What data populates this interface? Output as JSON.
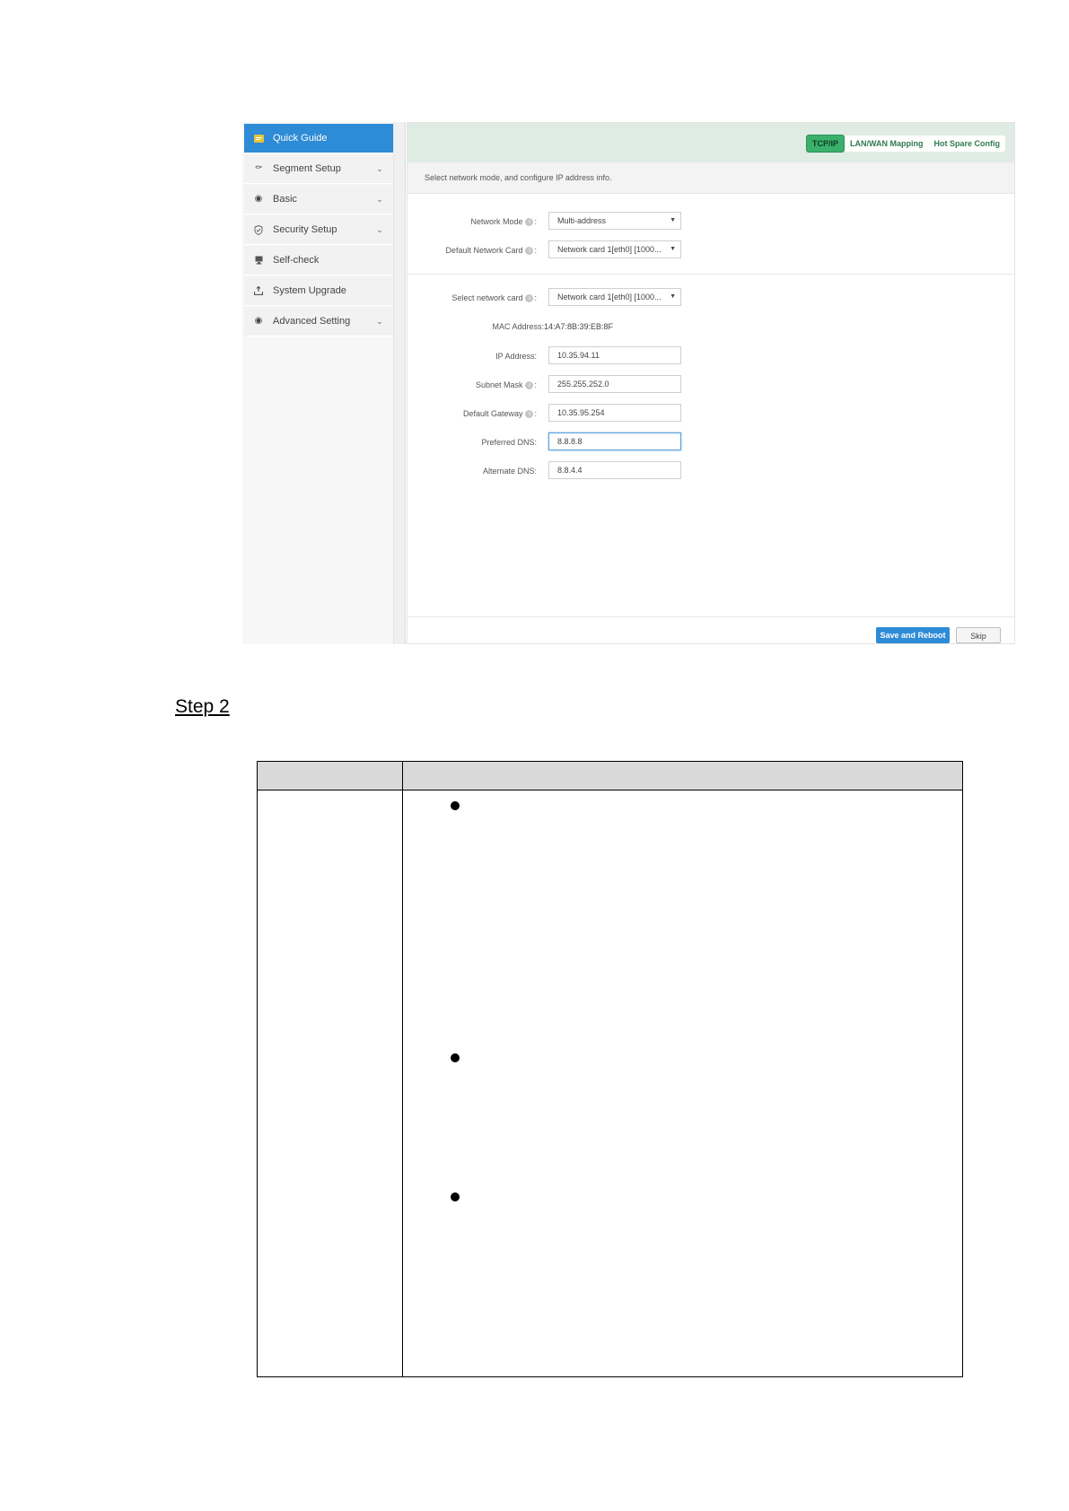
{
  "sidebar": {
    "items": [
      {
        "label": "Quick Guide",
        "icon": "quick-guide-icon",
        "expandable": false,
        "active": true
      },
      {
        "label": "Segment Setup",
        "icon": "segment-icon",
        "expandable": true,
        "active": false
      },
      {
        "label": "Basic",
        "icon": "basic-icon",
        "expandable": true,
        "active": false
      },
      {
        "label": "Security Setup",
        "icon": "shield-icon",
        "expandable": true,
        "active": false
      },
      {
        "label": "Self-check",
        "icon": "monitor-icon",
        "expandable": false,
        "active": false
      },
      {
        "label": "System Upgrade",
        "icon": "upload-icon",
        "expandable": false,
        "active": false
      },
      {
        "label": "Advanced Setting",
        "icon": "settings-icon",
        "expandable": true,
        "active": false
      }
    ]
  },
  "tabs": [
    "TCP/IP",
    "LAN/WAN Mapping",
    "Hot Spare Config"
  ],
  "instruction": "Select network mode, and configure IP address info.",
  "form": {
    "network_mode": {
      "label": "Network Mode",
      "value": "Multi-address"
    },
    "default_network_card": {
      "label": "Default Network Card",
      "value": "Network card 1[eth0] [1000..."
    },
    "select_network_card": {
      "label": "Select network card",
      "value": "Network card 1[eth0] [1000..."
    },
    "mac_address": {
      "label": "MAC Address:",
      "value": "14:A7:8B:39:EB:8F"
    },
    "ip_address": {
      "label": "IP Address:",
      "value": "10.35.94.11"
    },
    "subnet_mask": {
      "label": "Subnet Mask",
      "value": "255.255.252.0"
    },
    "default_gateway": {
      "label": "Default Gateway",
      "value": "10.35.95.254"
    },
    "preferred_dns": {
      "label": "Preferred DNS:",
      "value": "8.8.8.8"
    },
    "alternate_dns": {
      "label": "Alternate DNS:",
      "value": "8.8.4.4"
    }
  },
  "buttons": {
    "save": "Save and Reboot",
    "skip": "Skip"
  },
  "step_label": "Step 2",
  "colors": {
    "accent": "#2e8bd6",
    "tab_active": "#3bb06c",
    "topbar": "#dfece4"
  }
}
